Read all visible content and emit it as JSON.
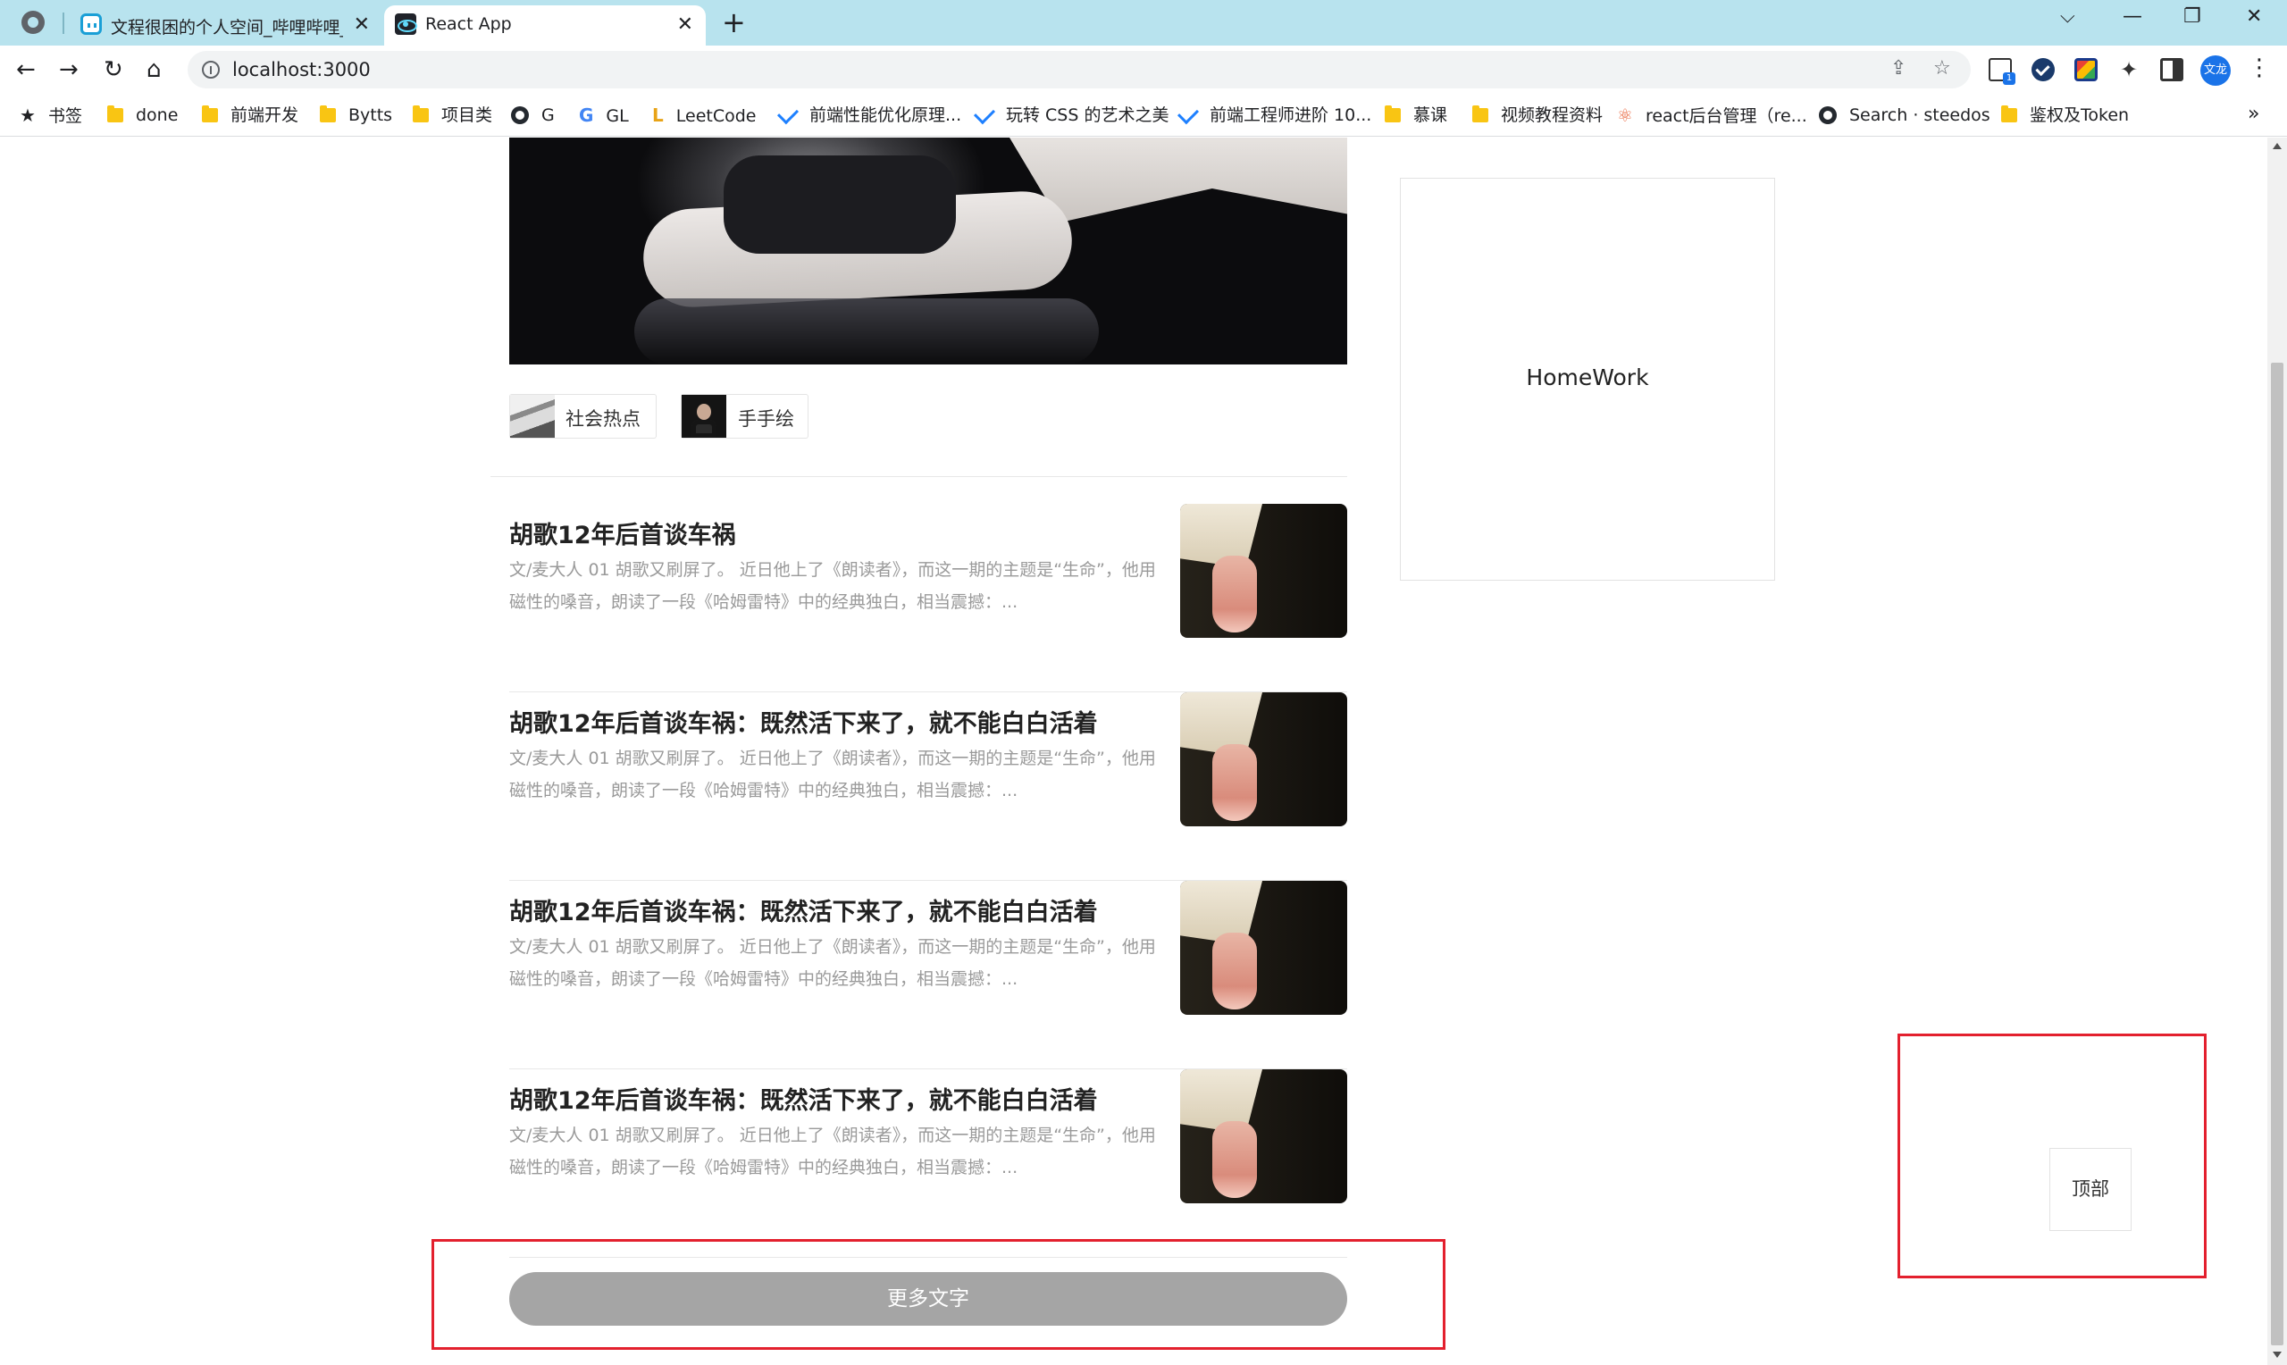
{
  "browser": {
    "tabs": [
      {
        "title": "文程很困的个人空间_哔哩哔哩_b",
        "favicon": "bilibili-icon",
        "close": "✕"
      },
      {
        "title": "React App",
        "favicon": "react-icon",
        "close": "✕"
      }
    ],
    "new_tab": "+",
    "window_controls": {
      "tab_search": "⌵",
      "minimize": "—",
      "restore": "❐",
      "close": "✕"
    },
    "nav": {
      "back": "←",
      "forward": "→",
      "reload": "↻",
      "home": "⌂"
    },
    "url": "localhost:3000",
    "omnibox_actions": {
      "share": "⇪",
      "bookmark": "☆"
    },
    "profile_text": "文龙",
    "menu": "⋮",
    "bookmarks_more": "»",
    "bookmarks": [
      {
        "label": "书签",
        "icon": "star-icon"
      },
      {
        "label": "done",
        "icon": "folder-icon"
      },
      {
        "label": "前端开发",
        "icon": "folder-icon"
      },
      {
        "label": "Bytts",
        "icon": "folder-icon"
      },
      {
        "label": "项目类",
        "icon": "folder-icon"
      },
      {
        "label": "G",
        "icon": "github-icon"
      },
      {
        "label": "GL",
        "icon": "google-icon"
      },
      {
        "label": "LeetCode",
        "icon": "leetcode-icon"
      },
      {
        "label": "前端性能优化原理...",
        "icon": "juejin-icon"
      },
      {
        "label": "玩转 CSS 的艺术之美",
        "icon": "juejin-icon"
      },
      {
        "label": "前端工程师进阶 10...",
        "icon": "juejin-icon"
      },
      {
        "label": "慕课",
        "icon": "folder-icon"
      },
      {
        "label": "视频教程资料",
        "icon": "folder-icon"
      },
      {
        "label": "react后台管理（re...",
        "icon": "react-icon"
      },
      {
        "label": "Search · steedos",
        "icon": "github-icon"
      },
      {
        "label": "鉴权及Token",
        "icon": "folder-icon"
      }
    ]
  },
  "page": {
    "tags": [
      {
        "label": "社会热点",
        "thumb": "news-thumbnail"
      },
      {
        "label": "手手绘",
        "thumb": "drawing-thumbnail"
      }
    ],
    "articles": [
      {
        "title": "胡歌12年后首谈车祸",
        "desc": "文/麦大人 01 胡歌又刷屏了。 近日他上了《朗读者》，而这一期的主题是“生命”，他用磁性的嗓音，朗读了一段《哈姆雷特》中的经典独白，相当震撼：..."
      },
      {
        "title": "胡歌12年后首谈车祸：既然活下来了，就不能白白活着",
        "desc": "文/麦大人 01 胡歌又刷屏了。 近日他上了《朗读者》，而这一期的主题是“生命”，他用磁性的嗓音，朗读了一段《哈姆雷特》中的经典独白，相当震撼：..."
      },
      {
        "title": "胡歌12年后首谈车祸：既然活下来了，就不能白白活着",
        "desc": "文/麦大人 01 胡歌又刷屏了。 近日他上了《朗读者》，而这一期的主题是“生命”，他用磁性的嗓音，朗读了一段《哈姆雷特》中的经典独白，相当震撼：..."
      },
      {
        "title": "胡歌12年后首谈车祸：既然活下来了，就不能白白活着",
        "desc": "文/麦大人 01 胡歌又刷屏了。 近日他上了《朗读者》，而这一期的主题是“生命”，他用磁性的嗓音，朗读了一段《哈姆雷特》中的经典独白，相当震撼：..."
      }
    ],
    "more_button": "更多文字",
    "homework": "HomeWork",
    "back_to_top": "顶部"
  },
  "colors": {
    "tab_strip": "#b8e3ee",
    "outline_red": "#e3202e",
    "more_button_bg": "#a5a5a5",
    "desc_text": "#9a9a9a"
  }
}
